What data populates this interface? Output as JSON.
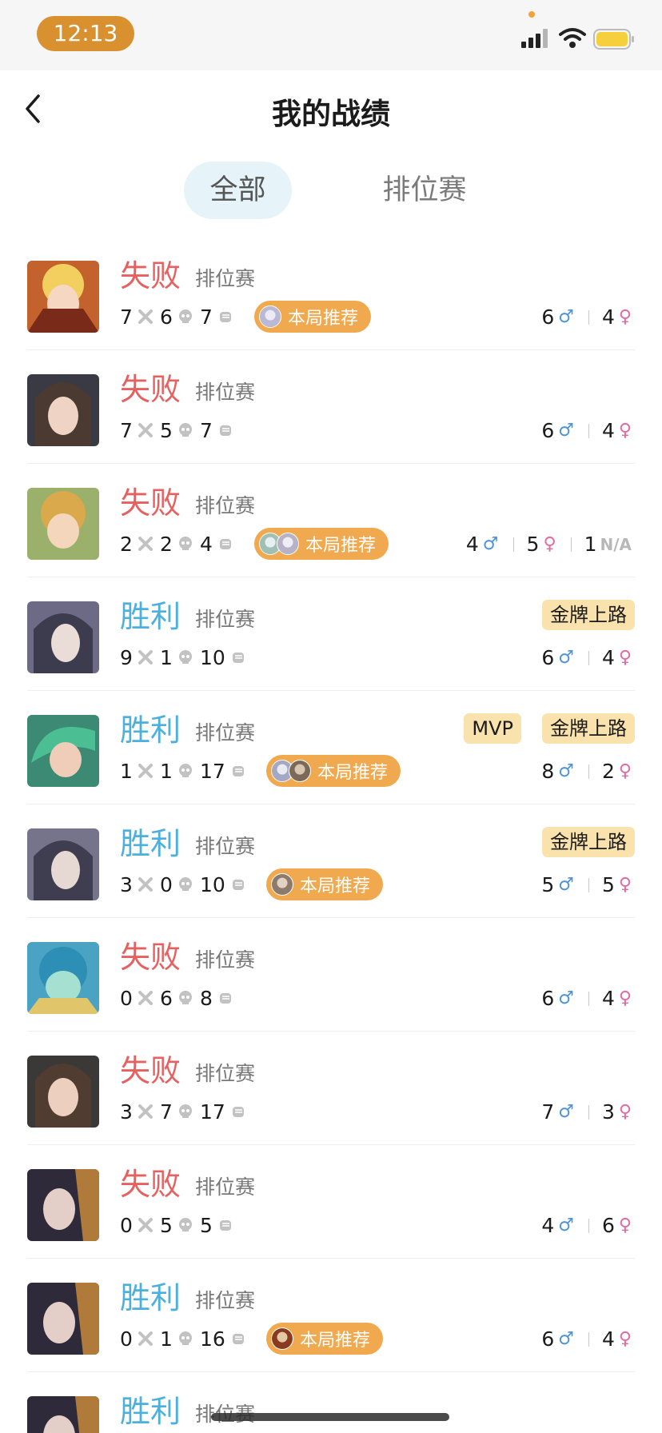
{
  "status_bar": {
    "time": "12:13"
  },
  "header": {
    "title": "我的战绩"
  },
  "tabs": [
    {
      "label": "全部",
      "active": true
    },
    {
      "label": "排位赛",
      "active": false
    }
  ],
  "colors": {
    "lose": "#e76060",
    "win": "#4cb0dd",
    "badge": "#f9e2ab",
    "recommend": "#f0a94f",
    "time_pill": "#d9902f"
  },
  "matches": [
    {
      "result": "失败",
      "mode": "排位赛",
      "kda": [
        "7",
        "6",
        "7"
      ],
      "recommend": "本局推荐",
      "male": "6",
      "female": "4"
    },
    {
      "result": "失败",
      "mode": "排位赛",
      "kda": [
        "7",
        "5",
        "7"
      ],
      "male": "6",
      "female": "4"
    },
    {
      "result": "失败",
      "mode": "排位赛",
      "kda": [
        "2",
        "2",
        "4"
      ],
      "recommend": "本局推荐",
      "male": "4",
      "female": "5",
      "na": "1",
      "na_label": "N/A"
    },
    {
      "result": "胜利",
      "mode": "排位赛",
      "kda": [
        "9",
        "1",
        "10"
      ],
      "badge": "金牌上路",
      "male": "6",
      "female": "4"
    },
    {
      "result": "胜利",
      "mode": "排位赛",
      "kda": [
        "1",
        "1",
        "17"
      ],
      "recommend": "本局推荐",
      "mvp": "MVP",
      "badge": "金牌上路",
      "male": "8",
      "female": "2"
    },
    {
      "result": "胜利",
      "mode": "排位赛",
      "kda": [
        "3",
        "0",
        "10"
      ],
      "recommend": "本局推荐",
      "badge": "金牌上路",
      "male": "5",
      "female": "5"
    },
    {
      "result": "失败",
      "mode": "排位赛",
      "kda": [
        "0",
        "6",
        "8"
      ],
      "male": "6",
      "female": "4"
    },
    {
      "result": "失败",
      "mode": "排位赛",
      "kda": [
        "3",
        "7",
        "17"
      ],
      "male": "7",
      "female": "3"
    },
    {
      "result": "失败",
      "mode": "排位赛",
      "kda": [
        "0",
        "5",
        "5"
      ],
      "male": "4",
      "female": "6"
    },
    {
      "result": "胜利",
      "mode": "排位赛",
      "kda": [
        "0",
        "1",
        "16"
      ],
      "recommend": "本局推荐",
      "male": "6",
      "female": "4"
    },
    {
      "result": "胜利",
      "mode": "排位赛"
    }
  ]
}
